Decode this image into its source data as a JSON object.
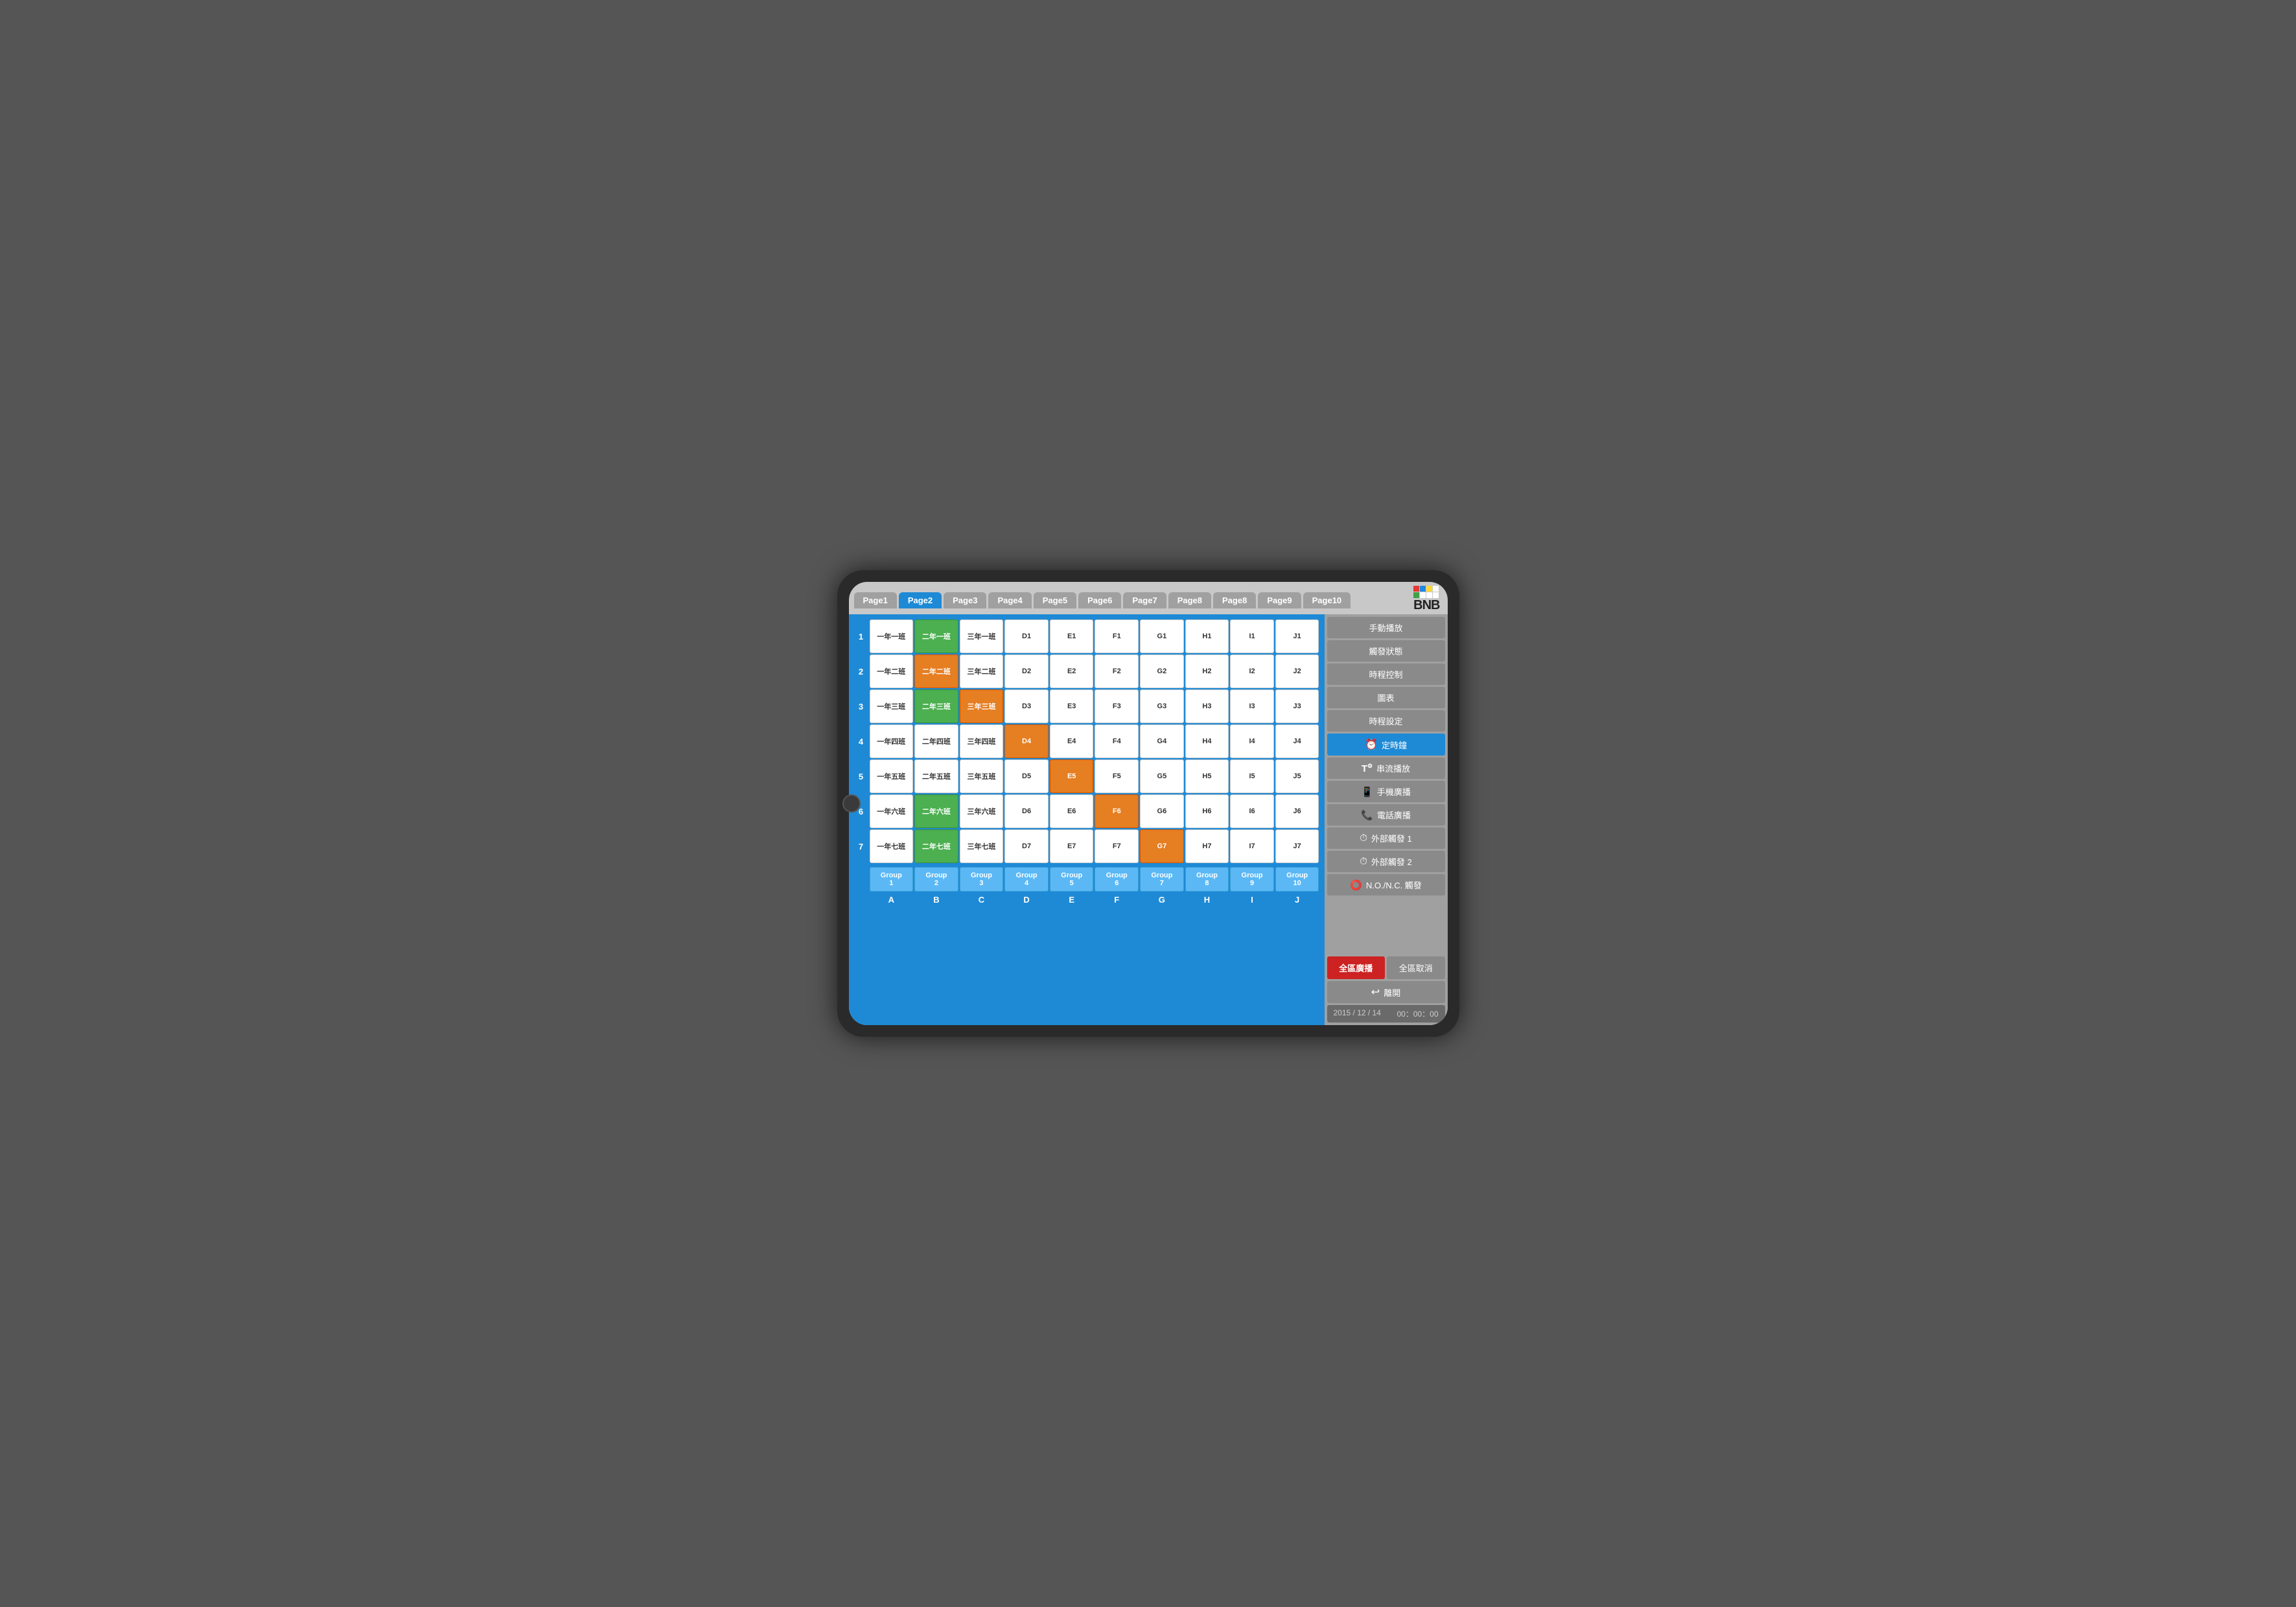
{
  "tabs": [
    {
      "label": "Page1",
      "active": false
    },
    {
      "label": "Page2",
      "active": true
    },
    {
      "label": "Page3",
      "active": false
    },
    {
      "label": "Page4",
      "active": false
    },
    {
      "label": "Page5",
      "active": false
    },
    {
      "label": "Page6",
      "active": false
    },
    {
      "label": "Page7",
      "active": false
    },
    {
      "label": "Page8",
      "active": false
    },
    {
      "label": "Page8",
      "active": false
    },
    {
      "label": "Page9",
      "active": false
    },
    {
      "label": "Page10",
      "active": false
    }
  ],
  "logo_colors": [
    "#e53935",
    "#43a047",
    "#1e88e5",
    "#fdd835",
    "#e53935",
    "#fdd835",
    "#1e88e5",
    "#43a047"
  ],
  "rows": [
    {
      "label": "1",
      "cells": [
        {
          "text": "一年一班",
          "color": "white"
        },
        {
          "text": "二年一班",
          "color": "green"
        },
        {
          "text": "三年一班",
          "color": "white"
        },
        {
          "text": "D1",
          "color": "white"
        },
        {
          "text": "E1",
          "color": "white"
        },
        {
          "text": "F1",
          "color": "white"
        },
        {
          "text": "G1",
          "color": "white"
        },
        {
          "text": "H1",
          "color": "white"
        },
        {
          "text": "I1",
          "color": "white"
        },
        {
          "text": "J1",
          "color": "white"
        }
      ]
    },
    {
      "label": "2",
      "cells": [
        {
          "text": "一年二班",
          "color": "white"
        },
        {
          "text": "二年二班",
          "color": "orange"
        },
        {
          "text": "三年二班",
          "color": "white"
        },
        {
          "text": "D2",
          "color": "white"
        },
        {
          "text": "E2",
          "color": "white"
        },
        {
          "text": "F2",
          "color": "white"
        },
        {
          "text": "G2",
          "color": "white"
        },
        {
          "text": "H2",
          "color": "white"
        },
        {
          "text": "I2",
          "color": "white"
        },
        {
          "text": "J2",
          "color": "white"
        }
      ]
    },
    {
      "label": "3",
      "cells": [
        {
          "text": "一年三班",
          "color": "white"
        },
        {
          "text": "二年三班",
          "color": "green"
        },
        {
          "text": "三年三班",
          "color": "orange"
        },
        {
          "text": "D3",
          "color": "white"
        },
        {
          "text": "E3",
          "color": "white"
        },
        {
          "text": "F3",
          "color": "white"
        },
        {
          "text": "G3",
          "color": "white"
        },
        {
          "text": "H3",
          "color": "white"
        },
        {
          "text": "I3",
          "color": "white"
        },
        {
          "text": "J3",
          "color": "white"
        }
      ]
    },
    {
      "label": "4",
      "cells": [
        {
          "text": "一年四班",
          "color": "white"
        },
        {
          "text": "二年四班",
          "color": "white"
        },
        {
          "text": "三年四班",
          "color": "white"
        },
        {
          "text": "D4",
          "color": "orange"
        },
        {
          "text": "E4",
          "color": "white"
        },
        {
          "text": "F4",
          "color": "white"
        },
        {
          "text": "G4",
          "color": "white"
        },
        {
          "text": "H4",
          "color": "white"
        },
        {
          "text": "I4",
          "color": "white"
        },
        {
          "text": "J4",
          "color": "white"
        }
      ]
    },
    {
      "label": "5",
      "cells": [
        {
          "text": "一年五班",
          "color": "white"
        },
        {
          "text": "二年五班",
          "color": "white"
        },
        {
          "text": "三年五班",
          "color": "white"
        },
        {
          "text": "D5",
          "color": "white"
        },
        {
          "text": "E5",
          "color": "orange"
        },
        {
          "text": "F5",
          "color": "white"
        },
        {
          "text": "G5",
          "color": "white"
        },
        {
          "text": "H5",
          "color": "white"
        },
        {
          "text": "I5",
          "color": "white"
        },
        {
          "text": "J5",
          "color": "white"
        }
      ]
    },
    {
      "label": "6",
      "cells": [
        {
          "text": "一年六班",
          "color": "white"
        },
        {
          "text": "二年六班",
          "color": "green"
        },
        {
          "text": "三年六班",
          "color": "white"
        },
        {
          "text": "D6",
          "color": "white"
        },
        {
          "text": "E6",
          "color": "white"
        },
        {
          "text": "F6",
          "color": "orange"
        },
        {
          "text": "G6",
          "color": "white"
        },
        {
          "text": "H6",
          "color": "white"
        },
        {
          "text": "I6",
          "color": "white"
        },
        {
          "text": "J6",
          "color": "white"
        }
      ]
    },
    {
      "label": "7",
      "cells": [
        {
          "text": "一年七班",
          "color": "white"
        },
        {
          "text": "二年七班",
          "color": "green"
        },
        {
          "text": "三年七班",
          "color": "white"
        },
        {
          "text": "D7",
          "color": "white"
        },
        {
          "text": "E7",
          "color": "white"
        },
        {
          "text": "F7",
          "color": "white"
        },
        {
          "text": "G7",
          "color": "orange"
        },
        {
          "text": "H7",
          "color": "white"
        },
        {
          "text": "I7",
          "color": "white"
        },
        {
          "text": "J7",
          "color": "white"
        }
      ]
    }
  ],
  "groups": [
    "Group\n1",
    "Group\n2",
    "Group\n3",
    "Group\n4",
    "Group\n5",
    "Group\n6",
    "Group\n7",
    "Group\n8",
    "Group\n9",
    "Group\n10"
  ],
  "col_labels": [
    "A",
    "B",
    "C",
    "D",
    "E",
    "F",
    "G",
    "H",
    "I",
    "J"
  ],
  "sidebar": {
    "menu": [
      {
        "label": "手動播放",
        "icon": null,
        "active": false
      },
      {
        "label": "觸發狀態",
        "icon": null,
        "active": false
      },
      {
        "label": "時程控制",
        "icon": null,
        "active": false
      },
      {
        "label": "圖表",
        "icon": null,
        "active": false
      },
      {
        "label": "時程設定",
        "icon": null,
        "active": false
      },
      {
        "label": "定時鐘",
        "icon": "clock",
        "active": true
      },
      {
        "label": "串流播放",
        "icon": "stream",
        "active": false
      },
      {
        "label": "手機廣播",
        "icon": "mobile",
        "active": false
      },
      {
        "label": "電話廣播",
        "icon": "phone",
        "active": false
      },
      {
        "label": "外部觸發 1",
        "icon": "trigger",
        "active": false
      },
      {
        "label": "外部觸發 2",
        "icon": "trigger",
        "active": false
      },
      {
        "label": "N.O./N.C. 觸發",
        "icon": "nc-trigger",
        "active": false
      }
    ],
    "broadcast_label": "全區廣播",
    "cancel_label": "全區取消",
    "leave_label": "離開",
    "datetime": "2015 / 12 / 14",
    "time": "00：00：00"
  }
}
